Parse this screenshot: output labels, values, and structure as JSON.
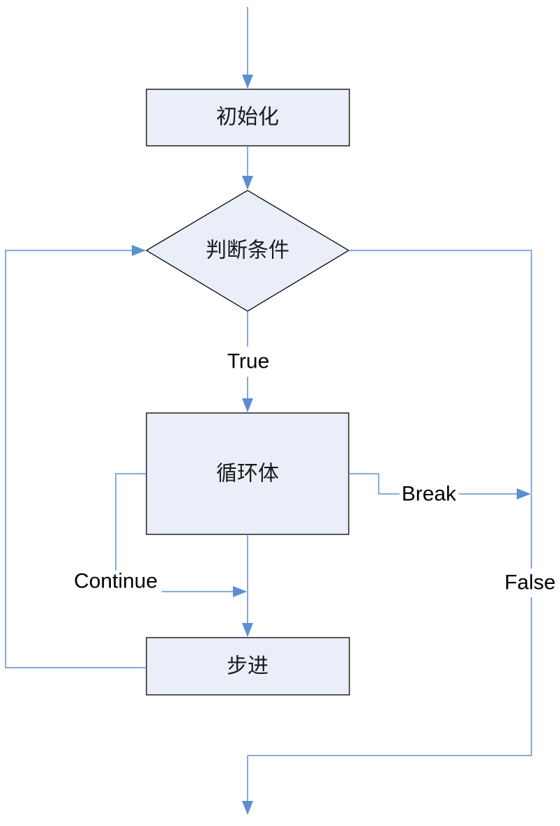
{
  "nodes": {
    "init": "初始化",
    "condition": "判断条件",
    "body": "循环体",
    "step": "步进"
  },
  "labels": {
    "true": "True",
    "false": "False",
    "break": "Break",
    "continue": "Continue"
  },
  "colors": {
    "box_fill": "#eaeef8",
    "box_stroke": "#000000",
    "line": "#5b8fd0"
  }
}
